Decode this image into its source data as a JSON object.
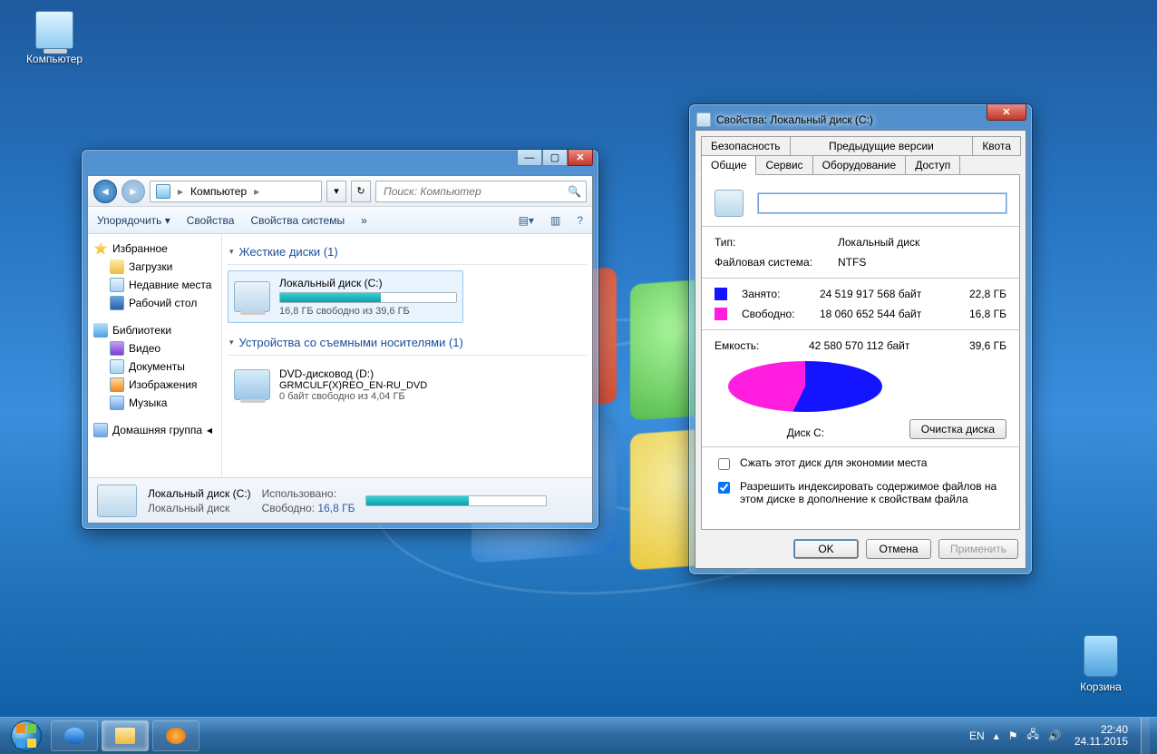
{
  "desktop": {
    "computer_label": "Компьютер",
    "recycle_label": "Корзина"
  },
  "explorer": {
    "title": "",
    "breadcrumb_root": "Компьютер",
    "breadcrumb_suffix": "▸",
    "search_placeholder": "Поиск: Компьютер",
    "toolbar": {
      "organize": "Упорядочить ▾",
      "properties": "Свойства",
      "system_properties": "Свойства системы",
      "more": "»"
    },
    "nav": {
      "favorites": "Избранное",
      "downloads": "Загрузки",
      "recent": "Недавние места",
      "desktop": "Рабочий стол",
      "libraries": "Библиотеки",
      "video": "Видео",
      "documents": "Документы",
      "images": "Изображения",
      "music": "Музыка",
      "homegroup": "Домашняя группа"
    },
    "groups": {
      "hdd": "Жесткие диски (1)",
      "removable": "Устройства со съемными носителями (1)"
    },
    "drive_c": {
      "name": "Локальный диск (C:)",
      "free_text": "16,8 ГБ свободно из 39,6 ГБ",
      "used_percent": 57
    },
    "drive_d": {
      "name": "DVD-дисковод (D:)",
      "vol": "GRMCULF(X)REO_EN-RU_DVD",
      "free_text": "0 байт свободно из 4,04 ГБ"
    },
    "details": {
      "title": "Локальный диск (C:)",
      "subtitle": "Локальный диск",
      "used_label": "Использовано:",
      "free_label": "Свободно:",
      "free_value": "16,8 ГБ"
    }
  },
  "props": {
    "title": "Свойства: Локальный диск (C:)",
    "tabs": {
      "security": "Безопасность",
      "prev": "Предыдущие версии",
      "quota": "Квота",
      "general": "Общие",
      "tools": "Сервис",
      "hardware": "Оборудование",
      "sharing": "Доступ"
    },
    "name_value": "",
    "type_label": "Тип:",
    "type_value": "Локальный диск",
    "fs_label": "Файловая система:",
    "fs_value": "NTFS",
    "used_label": "Занято:",
    "used_bytes": "24 519 917 568 байт",
    "used_gb": "22,8 ГБ",
    "free_label": "Свободно:",
    "free_bytes": "18 060 652 544 байт",
    "free_gb": "16,8 ГБ",
    "cap_label": "Емкость:",
    "cap_bytes": "42 580 570 112 байт",
    "cap_gb": "39,6 ГБ",
    "disk_caption": "Диск C:",
    "cleanup": "Очистка диска",
    "compress": "Сжать этот диск для экономии места",
    "index": "Разрешить индексировать содержимое файлов на этом диске в дополнение к свойствам файла",
    "ok": "OK",
    "cancel": "Отмена",
    "apply": "Применить"
  },
  "taskbar": {
    "lang": "EN",
    "time": "22:40",
    "date": "24.11.2015"
  },
  "chart_data": {
    "type": "pie",
    "title": "Диск C:",
    "series": [
      {
        "name": "Занято",
        "value_bytes": 24519917568,
        "value_gb": 22.8,
        "color": "#1414ff"
      },
      {
        "name": "Свободно",
        "value_bytes": 18060652544,
        "value_gb": 16.8,
        "color": "#ff1ee0"
      }
    ],
    "total_bytes": 42580570112,
    "total_gb": 39.6
  }
}
